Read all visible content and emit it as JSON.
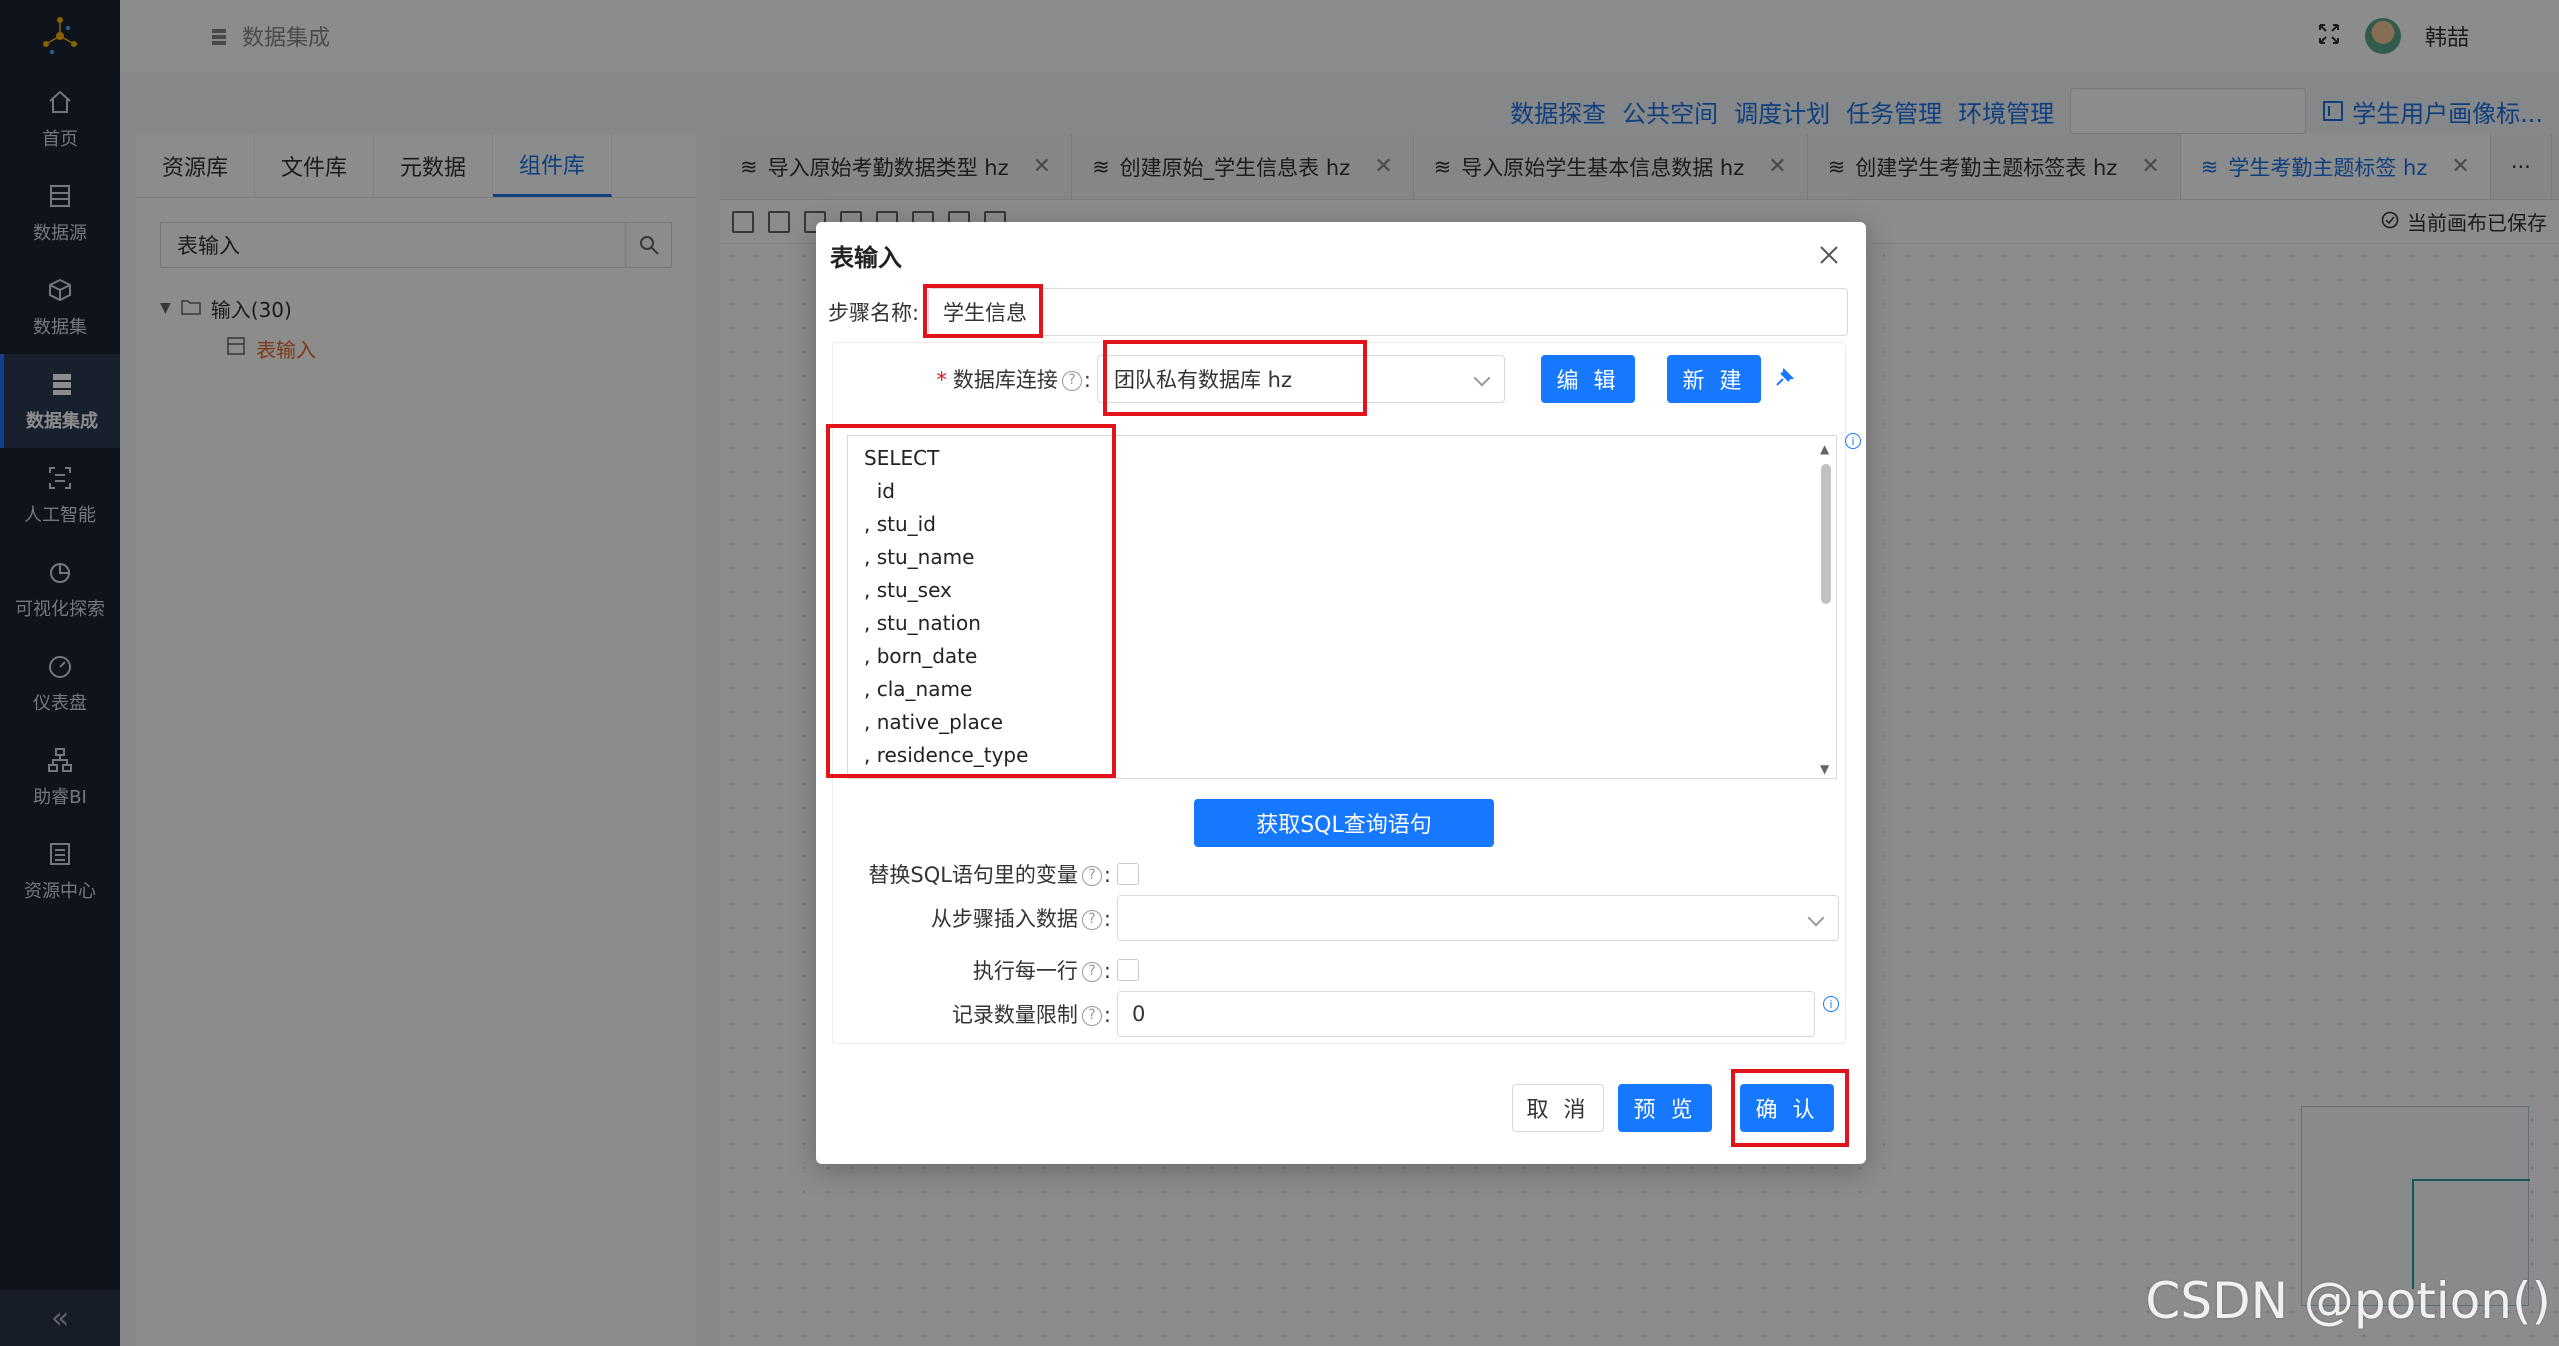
{
  "nav": {
    "items": [
      {
        "label": "首页",
        "icon": "home-icon"
      },
      {
        "label": "数据源",
        "icon": "database-icon"
      },
      {
        "label": "数据集",
        "icon": "cube-icon"
      },
      {
        "label": "数据集成",
        "icon": "server-icon"
      },
      {
        "label": "人工智能",
        "icon": "ai-icon"
      },
      {
        "label": "可视化探索",
        "icon": "pie-chart-icon"
      },
      {
        "label": "仪表盘",
        "icon": "gauge-icon"
      },
      {
        "label": "助睿BI",
        "icon": "org-chart-icon"
      },
      {
        "label": "资源中心",
        "icon": "resource-icon"
      }
    ],
    "active_index": 3,
    "collapse": "«"
  },
  "header": {
    "breadcrumb": "数据集成",
    "user": "韩喆"
  },
  "toolbar": {
    "links": [
      "数据探查",
      "公共空间",
      "调度计划",
      "任务管理",
      "环境管理"
    ],
    "project": "学生用户画像标..."
  },
  "left_panel": {
    "tabs": [
      "资源库",
      "文件库",
      "元数据",
      "组件库"
    ],
    "active_tab": 3,
    "search_value": "表输入",
    "tree": {
      "folder": "输入(30)",
      "child": "表输入"
    }
  },
  "editor_tabs": [
    {
      "label": "导入原始考勤数据类型 hz"
    },
    {
      "label": "创建原始_学生信息表 hz"
    },
    {
      "label": "导入原始学生基本信息数据 hz"
    },
    {
      "label": "创建学生考勤主题标签表 hz"
    },
    {
      "label": "学生考勤主题标签 hz"
    }
  ],
  "more": "···",
  "canvas_status": "当前画布已保存",
  "watermark": "CSDN @potion()",
  "dialog": {
    "title": "表输入",
    "step_name_label": "步骤名称:",
    "step_name_value": "学生信息",
    "db_label": "数据库连接",
    "db_value": "团队私有数据库 hz",
    "edit_btn": "编 辑",
    "new_btn": "新 建",
    "sql_lines": [
      "SELECT",
      "  id",
      ", stu_id",
      ", stu_name",
      ", stu_sex",
      ", stu_nation",
      ", born_date",
      ", cla_name",
      ", native_place",
      ", residence_type"
    ],
    "get_sql_btn": "获取SQL查询语句",
    "replace_vars_label": "替换SQL语句里的变量",
    "insert_from_label": "从步骤插入数据",
    "exec_each_label": "执行每一行",
    "limit_label": "记录数量限制",
    "limit_value": "0",
    "cancel_btn": "取 消",
    "preview_btn": "预 览",
    "confirm_btn": "确 认"
  },
  "colors": {
    "sidebar": "#1b2434",
    "primary": "#1677ff",
    "highlight": "#e0141a"
  }
}
